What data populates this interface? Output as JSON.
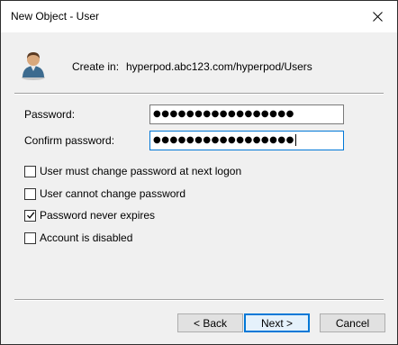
{
  "window": {
    "title": "New Object - User"
  },
  "header": {
    "create_in_label": "Create in:",
    "create_in_path": "hyperpod.abc123.com/hyperpod/Users"
  },
  "form": {
    "password_label": "Password:",
    "password_value": "●●●●●●●●●●●●●●●●●",
    "confirm_label": "Confirm password:",
    "confirm_value": "●●●●●●●●●●●●●●●●●"
  },
  "options": [
    {
      "label": "User must change password at next logon",
      "checked": false
    },
    {
      "label": "User cannot change password",
      "checked": false
    },
    {
      "label": "Password never expires",
      "checked": true
    },
    {
      "label": "Account is disabled",
      "checked": false
    }
  ],
  "buttons": {
    "back": "< Back",
    "next": "Next >",
    "cancel": "Cancel"
  },
  "icons": {
    "user": "user-icon",
    "close": "close-icon",
    "check": "checkmark-icon"
  },
  "colors": {
    "focus_border": "#0078d7",
    "dialog_bg": "#f0f0f0"
  }
}
